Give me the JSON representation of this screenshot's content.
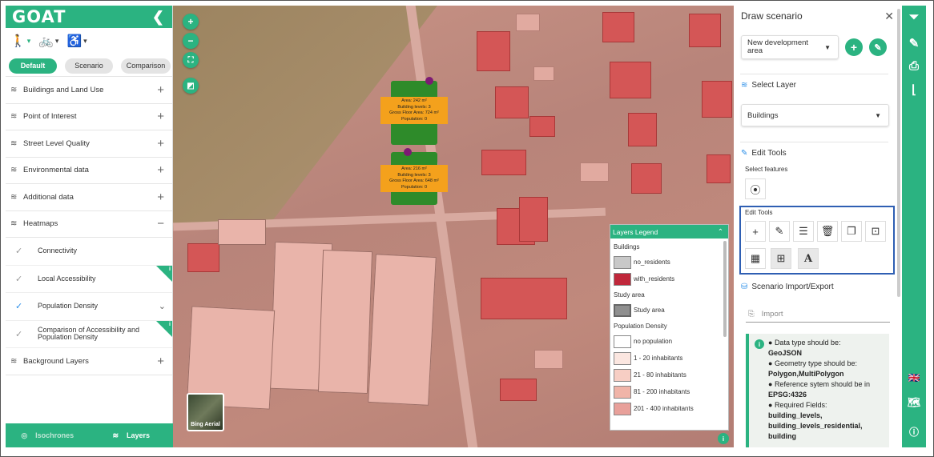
{
  "app": {
    "logo": "GOAT",
    "collapse_icon": "chevron-left-icon"
  },
  "modes": [
    {
      "name": "walking",
      "glyph": "🚶"
    },
    {
      "name": "cycling",
      "glyph": "🚲"
    },
    {
      "name": "wheelchair",
      "glyph": "♿"
    }
  ],
  "tabs": [
    "Default",
    "Scenario",
    "Comparison"
  ],
  "menu": {
    "buildings": "Buildings and Land Use",
    "poi": "Point of Interest",
    "street": "Street Level Quality",
    "env": "Environmental data",
    "additional": "Additional data",
    "heatmaps": "Heatmaps",
    "background": "Background Layers"
  },
  "heatmaps": [
    {
      "label": "Connectivity"
    },
    {
      "label": "Local Accessibility"
    },
    {
      "label": "Population Density"
    },
    {
      "label": "Comparison of Accessibility and Population Density"
    }
  ],
  "bottom_tabs": {
    "isochrones": "Isochrones",
    "layers": "Layers"
  },
  "map": {
    "bing_label": "Bing Aerial",
    "labels": [
      {
        "area": "Area: 242 m²",
        "levels": "Building levels: 3",
        "gfa": "Gross Floor Area: 724 m²",
        "pop": "Population: 0"
      },
      {
        "area": "Area: 216 m²",
        "levels": "Building levels: 3",
        "gfa": "Gross Floor Area: 648 m²",
        "pop": "Population: 0"
      }
    ]
  },
  "legend": {
    "title": "Layers Legend",
    "buildings_title": "Buildings",
    "no_residents": "no_residents",
    "with_residents": "with_residents",
    "study_title": "Study area",
    "study_area": "Study area",
    "pop_title": "Population Density",
    "pop_items": [
      "no population",
      "1 - 20 inhabitants",
      "21 - 80 inhabitants",
      "81 - 200 inhabitants",
      "201 - 400 inhabitants"
    ],
    "colors": {
      "no_residents": "#c8c8c8",
      "with_residents": "#c0283b",
      "study_area": "#8f8f8f",
      "pop": [
        "#ffffff",
        "#fbe6e0",
        "#f7cec4",
        "#f0b4a8",
        "#e8a09a"
      ]
    }
  },
  "draw": {
    "title": "Draw scenario",
    "scenario_select": "New development area",
    "select_layer_title": "Select Layer",
    "layer_value": "Buildings",
    "edit_tools_title": "Edit Tools",
    "select_features": "Select features",
    "edit_tools_small": "Edit Tools",
    "import_title": "Scenario Import/Export",
    "import_placeholder": "Import",
    "info": {
      "l1": "Data type should be:",
      "v1": "GeoJSON",
      "l2": "Geometry type should be:",
      "v2": "Polygon,MultiPolygon",
      "l3": "Reference sytem should be in",
      "v3": "EPSG:4326",
      "l4": "Required Fields:",
      "v4": "building_levels, building_levels_residential, building"
    }
  },
  "colors": {
    "accent": "#2bb381",
    "highlight": "#2f5fb3"
  }
}
